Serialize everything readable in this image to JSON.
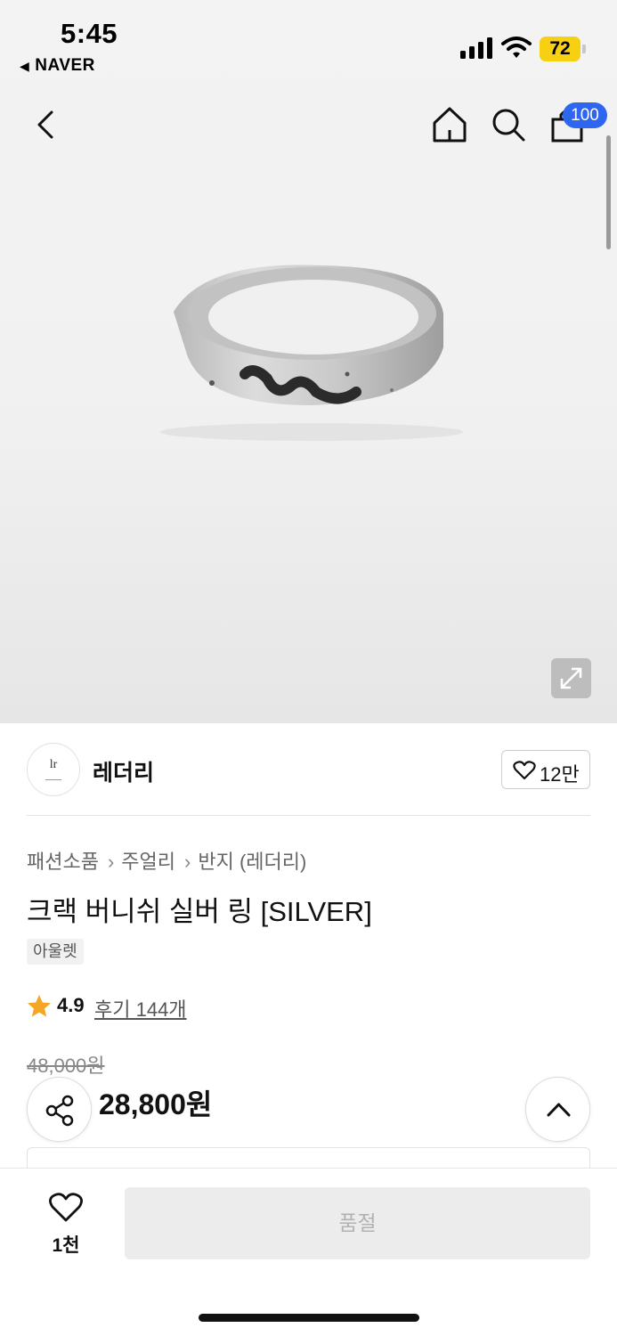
{
  "status_bar": {
    "time": "5:45",
    "back_app": "NAVER",
    "battery": "72"
  },
  "header": {
    "cart_badge": "100"
  },
  "store": {
    "logo_text": "lr",
    "name": "레더리",
    "follow_count": "12만"
  },
  "product": {
    "breadcrumb": [
      "패션소품",
      "주얼리",
      "반지 (레더리)"
    ],
    "title": "크랙 버니쉬 실버 링 [SILVER]",
    "tag": "아울렛",
    "rating": "4.9",
    "reviews": "후기 144개",
    "original_price": "48,000원",
    "price": "28,800원"
  },
  "bottom_bar": {
    "wish_count": "1천",
    "soldout_label": "품절"
  },
  "icons": {
    "back": "chevron-left-icon",
    "home": "home-icon",
    "search": "search-icon",
    "cart": "shopping-bag-icon",
    "expand": "expand-icon",
    "follow_heart": "heart-icon",
    "star": "star-icon",
    "share": "share-icon",
    "scroll_top": "chevron-up-icon",
    "wish": "heart-icon"
  },
  "colors": {
    "badge_blue": "#2e66ef",
    "star_orange": "#f5a623",
    "battery_yellow": "#f7d013"
  }
}
